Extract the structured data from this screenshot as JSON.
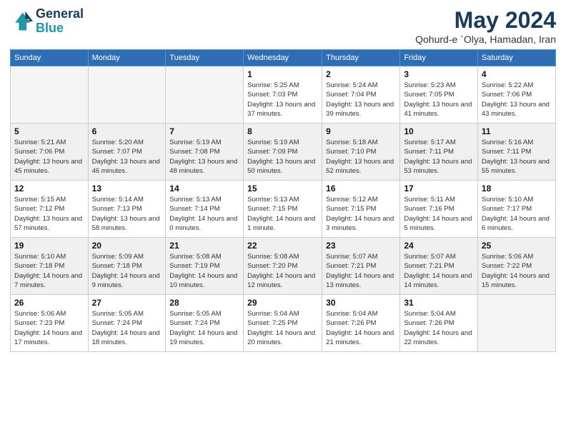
{
  "logo": {
    "line1": "General",
    "line2": "Blue"
  },
  "title": "May 2024",
  "subtitle": "Qohurd-e `Olya, Hamadan, Iran",
  "days_of_week": [
    "Sunday",
    "Monday",
    "Tuesday",
    "Wednesday",
    "Thursday",
    "Friday",
    "Saturday"
  ],
  "weeks": [
    [
      {
        "day": "",
        "info": ""
      },
      {
        "day": "",
        "info": ""
      },
      {
        "day": "",
        "info": ""
      },
      {
        "day": "1",
        "info": "Sunrise: 5:25 AM\nSunset: 7:03 PM\nDaylight: 13 hours and 37 minutes."
      },
      {
        "day": "2",
        "info": "Sunrise: 5:24 AM\nSunset: 7:04 PM\nDaylight: 13 hours and 39 minutes."
      },
      {
        "day": "3",
        "info": "Sunrise: 5:23 AM\nSunset: 7:05 PM\nDaylight: 13 hours and 41 minutes."
      },
      {
        "day": "4",
        "info": "Sunrise: 5:22 AM\nSunset: 7:06 PM\nDaylight: 13 hours and 43 minutes."
      }
    ],
    [
      {
        "day": "5",
        "info": "Sunrise: 5:21 AM\nSunset: 7:06 PM\nDaylight: 13 hours and 45 minutes."
      },
      {
        "day": "6",
        "info": "Sunrise: 5:20 AM\nSunset: 7:07 PM\nDaylight: 13 hours and 46 minutes."
      },
      {
        "day": "7",
        "info": "Sunrise: 5:19 AM\nSunset: 7:08 PM\nDaylight: 13 hours and 48 minutes."
      },
      {
        "day": "8",
        "info": "Sunrise: 5:19 AM\nSunset: 7:09 PM\nDaylight: 13 hours and 50 minutes."
      },
      {
        "day": "9",
        "info": "Sunrise: 5:18 AM\nSunset: 7:10 PM\nDaylight: 13 hours and 52 minutes."
      },
      {
        "day": "10",
        "info": "Sunrise: 5:17 AM\nSunset: 7:11 PM\nDaylight: 13 hours and 53 minutes."
      },
      {
        "day": "11",
        "info": "Sunrise: 5:16 AM\nSunset: 7:11 PM\nDaylight: 13 hours and 55 minutes."
      }
    ],
    [
      {
        "day": "12",
        "info": "Sunrise: 5:15 AM\nSunset: 7:12 PM\nDaylight: 13 hours and 57 minutes."
      },
      {
        "day": "13",
        "info": "Sunrise: 5:14 AM\nSunset: 7:13 PM\nDaylight: 13 hours and 58 minutes."
      },
      {
        "day": "14",
        "info": "Sunrise: 5:13 AM\nSunset: 7:14 PM\nDaylight: 14 hours and 0 minutes."
      },
      {
        "day": "15",
        "info": "Sunrise: 5:13 AM\nSunset: 7:15 PM\nDaylight: 14 hours and 1 minute."
      },
      {
        "day": "16",
        "info": "Sunrise: 5:12 AM\nSunset: 7:15 PM\nDaylight: 14 hours and 3 minutes."
      },
      {
        "day": "17",
        "info": "Sunrise: 5:11 AM\nSunset: 7:16 PM\nDaylight: 14 hours and 5 minutes."
      },
      {
        "day": "18",
        "info": "Sunrise: 5:10 AM\nSunset: 7:17 PM\nDaylight: 14 hours and 6 minutes."
      }
    ],
    [
      {
        "day": "19",
        "info": "Sunrise: 5:10 AM\nSunset: 7:18 PM\nDaylight: 14 hours and 7 minutes."
      },
      {
        "day": "20",
        "info": "Sunrise: 5:09 AM\nSunset: 7:18 PM\nDaylight: 14 hours and 9 minutes."
      },
      {
        "day": "21",
        "info": "Sunrise: 5:08 AM\nSunset: 7:19 PM\nDaylight: 14 hours and 10 minutes."
      },
      {
        "day": "22",
        "info": "Sunrise: 5:08 AM\nSunset: 7:20 PM\nDaylight: 14 hours and 12 minutes."
      },
      {
        "day": "23",
        "info": "Sunrise: 5:07 AM\nSunset: 7:21 PM\nDaylight: 14 hours and 13 minutes."
      },
      {
        "day": "24",
        "info": "Sunrise: 5:07 AM\nSunset: 7:21 PM\nDaylight: 14 hours and 14 minutes."
      },
      {
        "day": "25",
        "info": "Sunrise: 5:06 AM\nSunset: 7:22 PM\nDaylight: 14 hours and 15 minutes."
      }
    ],
    [
      {
        "day": "26",
        "info": "Sunrise: 5:06 AM\nSunset: 7:23 PM\nDaylight: 14 hours and 17 minutes."
      },
      {
        "day": "27",
        "info": "Sunrise: 5:05 AM\nSunset: 7:24 PM\nDaylight: 14 hours and 18 minutes."
      },
      {
        "day": "28",
        "info": "Sunrise: 5:05 AM\nSunset: 7:24 PM\nDaylight: 14 hours and 19 minutes."
      },
      {
        "day": "29",
        "info": "Sunrise: 5:04 AM\nSunset: 7:25 PM\nDaylight: 14 hours and 20 minutes."
      },
      {
        "day": "30",
        "info": "Sunrise: 5:04 AM\nSunset: 7:26 PM\nDaylight: 14 hours and 21 minutes."
      },
      {
        "day": "31",
        "info": "Sunrise: 5:04 AM\nSunset: 7:26 PM\nDaylight: 14 hours and 22 minutes."
      },
      {
        "day": "",
        "info": ""
      }
    ]
  ]
}
